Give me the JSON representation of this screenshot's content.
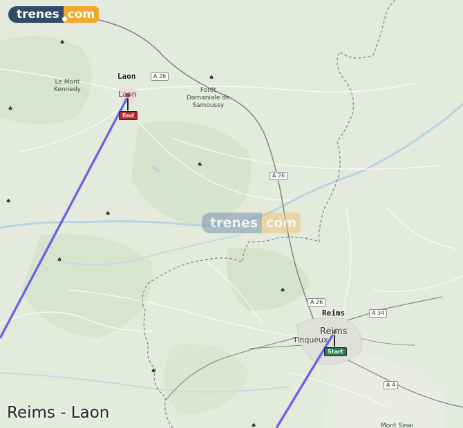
{
  "logo": {
    "left": "trenes",
    "right": "com"
  },
  "watermark": {
    "left": "trenes",
    "right": "com"
  },
  "title": "Reims - Laon",
  "cities": {
    "origin": "Reims",
    "destination": "Laon"
  },
  "markers": {
    "start": "Start",
    "end": "End"
  },
  "places": {
    "le_mont_kennedy": "Le Mont\nKennedy",
    "laon_map": "Laon",
    "foret": "Forêt\nDomaniale de\nSamoussy",
    "reims_map": "Reims",
    "tinqueux": "Tinqueux",
    "mont_sinai": "Mont Sinai"
  },
  "roads": {
    "a26_1": "A 26",
    "a26_2": "A 26",
    "a26_3": "A 26",
    "a34": "A 34",
    "a4": "A 4"
  },
  "colors": {
    "route": "#6666e8",
    "brand_dark": "#2f4b68",
    "brand_orange": "#f4a82b",
    "map_bg": "#e4ebdc",
    "water": "#b8d3df"
  }
}
